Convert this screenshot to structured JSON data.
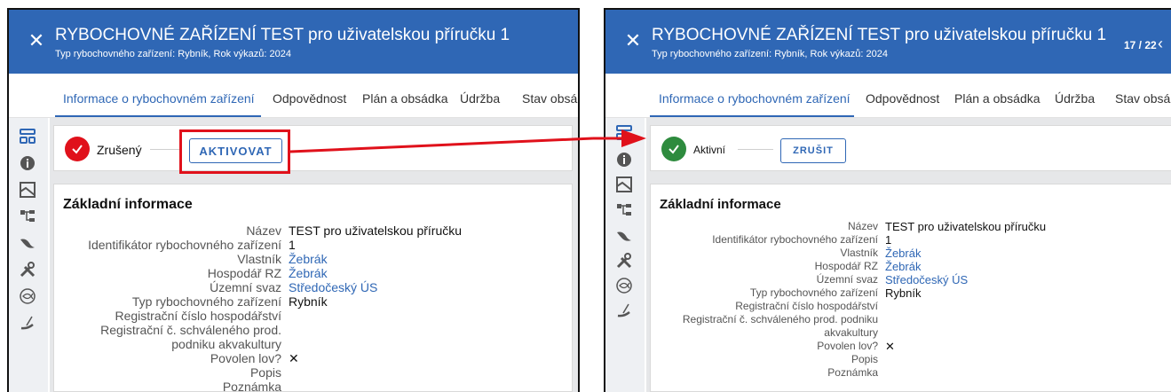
{
  "colors": {
    "header": "#2f67b5",
    "accent": "#2f67b5",
    "cancelled": "#e0111b",
    "active": "#2e8b3e",
    "callout": "#e0111b"
  },
  "header": {
    "close_icon": "close-icon",
    "title": "RYBOCHOVNÉ ZAŘÍZENÍ TEST pro uživatelskou příručku 1",
    "subtitle": "Typ rybochovného zařízení: Rybník, Rok výkazů: 2024",
    "pager": "17 / 22",
    "pager_prev_icon": "chevron-left-icon"
  },
  "tabs": [
    "Informace o rybochovném zařízení",
    "Odpovědnost",
    "Plán a obsádka",
    "Údržba",
    "Stav obsá"
  ],
  "sidebar": {
    "icons": [
      "hierarchy-icon",
      "info-icon",
      "map-icon",
      "structure-icon",
      "bird-icon",
      "tools-icon",
      "fish-icon",
      "fishing-icon"
    ]
  },
  "before": {
    "status_label": "Zrušený",
    "status_icon": "check-icon",
    "button_label": "AKTIVOVAT"
  },
  "after": {
    "status_label": "Aktivní",
    "status_icon": "check-icon",
    "button_label": "ZRUŠIT"
  },
  "info": {
    "title": "Základní informace",
    "rows": [
      {
        "label": "Název",
        "value": "TEST pro uživatelskou příručku"
      },
      {
        "label": "Identifikátor rybochovného zařízení",
        "value": "1"
      },
      {
        "label": "Vlastník",
        "value": "Žebrák"
      },
      {
        "label": "Hospodář RZ",
        "value": "Žebrák"
      },
      {
        "label": "Územní svaz",
        "value": "Středočeský ÚS"
      },
      {
        "label": "Typ rybochovného zařízení",
        "value": "Rybník"
      },
      {
        "label": "Registrační číslo hospodářství",
        "value": ""
      },
      {
        "label": "Registrační č. schváleného prod. podniku akvakultury",
        "value": ""
      },
      {
        "label": "Povolen lov?",
        "value": "✕"
      },
      {
        "label": "Popis",
        "value": ""
      },
      {
        "label": "Poznámka",
        "value": ""
      }
    ]
  }
}
